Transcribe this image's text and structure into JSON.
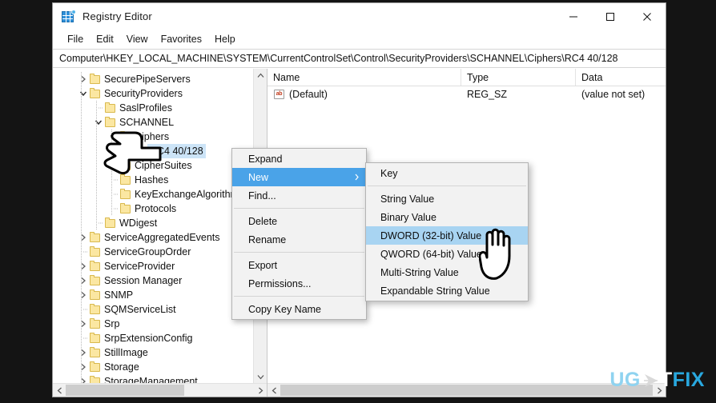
{
  "window": {
    "title": "Registry Editor",
    "icon": "registry-grid-icon",
    "controls": {
      "minimize": "–",
      "maximize": "□",
      "close": "✕"
    }
  },
  "menubar": {
    "items": [
      "File",
      "Edit",
      "View",
      "Favorites",
      "Help"
    ]
  },
  "address": {
    "path": "Computer\\HKEY_LOCAL_MACHINE\\SYSTEM\\CurrentControlSet\\Control\\SecurityProviders\\SCHANNEL\\Ciphers\\RC4 40/128"
  },
  "tree": {
    "items": [
      {
        "label": "SecurePipeServers",
        "depth": 1,
        "twisty": "collapsed",
        "selected": false
      },
      {
        "label": "SecurityProviders",
        "depth": 1,
        "twisty": "expanded",
        "selected": false
      },
      {
        "label": "SaslProfiles",
        "depth": 2,
        "twisty": "none",
        "selected": false
      },
      {
        "label": "SCHANNEL",
        "depth": 2,
        "twisty": "expanded",
        "selected": false
      },
      {
        "label": "Ciphers",
        "depth": 3,
        "twisty": "expanded",
        "selected": false
      },
      {
        "label": "RC4 40/128",
        "depth": 4,
        "twisty": "none",
        "selected": true
      },
      {
        "label": "CipherSuites",
        "depth": 3,
        "twisty": "none",
        "selected": false
      },
      {
        "label": "Hashes",
        "depth": 3,
        "twisty": "none",
        "selected": false
      },
      {
        "label": "KeyExchangeAlgorithms",
        "depth": 3,
        "twisty": "none",
        "selected": false
      },
      {
        "label": "Protocols",
        "depth": 3,
        "twisty": "none",
        "selected": false
      },
      {
        "label": "WDigest",
        "depth": 2,
        "twisty": "none",
        "selected": false
      },
      {
        "label": "ServiceAggregatedEvents",
        "depth": 1,
        "twisty": "collapsed",
        "selected": false
      },
      {
        "label": "ServiceGroupOrder",
        "depth": 1,
        "twisty": "none",
        "selected": false
      },
      {
        "label": "ServiceProvider",
        "depth": 1,
        "twisty": "collapsed",
        "selected": false
      },
      {
        "label": "Session Manager",
        "depth": 1,
        "twisty": "collapsed",
        "selected": false
      },
      {
        "label": "SNMP",
        "depth": 1,
        "twisty": "collapsed",
        "selected": false
      },
      {
        "label": "SQMServiceList",
        "depth": 1,
        "twisty": "none",
        "selected": false
      },
      {
        "label": "Srp",
        "depth": 1,
        "twisty": "collapsed",
        "selected": false
      },
      {
        "label": "SrpExtensionConfig",
        "depth": 1,
        "twisty": "none",
        "selected": false
      },
      {
        "label": "StillImage",
        "depth": 1,
        "twisty": "collapsed",
        "selected": false
      },
      {
        "label": "Storage",
        "depth": 1,
        "twisty": "collapsed",
        "selected": false
      },
      {
        "label": "StorageManagement",
        "depth": 1,
        "twisty": "collapsed",
        "selected": false
      }
    ]
  },
  "values": {
    "columns": [
      "Name",
      "Type",
      "Data"
    ],
    "rows": [
      {
        "icon": "string-value-icon",
        "name": "(Default)",
        "type": "REG_SZ",
        "data": "(value not set)"
      }
    ]
  },
  "context_menu": {
    "items": [
      {
        "label": "Expand",
        "highlighted": false,
        "submenu": false
      },
      {
        "label": "New",
        "highlighted": true,
        "submenu": true
      },
      {
        "label": "Find...",
        "highlighted": false,
        "submenu": false
      },
      {
        "separator": true
      },
      {
        "label": "Delete",
        "highlighted": false,
        "submenu": false
      },
      {
        "label": "Rename",
        "highlighted": false,
        "submenu": false
      },
      {
        "separator": true
      },
      {
        "label": "Export",
        "highlighted": false,
        "submenu": false
      },
      {
        "label": "Permissions...",
        "highlighted": false,
        "submenu": false
      },
      {
        "separator": true
      },
      {
        "label": "Copy Key Name",
        "highlighted": false,
        "submenu": false
      }
    ]
  },
  "submenu": {
    "items": [
      {
        "label": "Key",
        "highlighted": false
      },
      {
        "separator": true
      },
      {
        "label": "String Value",
        "highlighted": false
      },
      {
        "label": "Binary Value",
        "highlighted": false
      },
      {
        "label": "DWORD (32-bit) Value",
        "highlighted": true
      },
      {
        "label": "QWORD (64-bit) Value",
        "highlighted": false
      },
      {
        "label": "Multi-String Value",
        "highlighted": false
      },
      {
        "label": "Expandable String Value",
        "highlighted": false
      }
    ]
  },
  "cursors": [
    {
      "name": "hand-pointer-left",
      "target": "RC4 40/128"
    },
    {
      "name": "hand-pointer-up",
      "target": "DWORD (32-bit) Value"
    }
  ],
  "watermark": {
    "part1": "UG",
    "part2": "T",
    "part3": "FIX",
    "full": "UGETFIX"
  },
  "colors": {
    "selection": "#cce4f7",
    "menu_highlight": "#4aa3e8",
    "submenu_highlight": "#a8d4f2",
    "folder": "#fbe7a2",
    "backdrop": "#141414",
    "watermark_accent": "#29a8df"
  }
}
